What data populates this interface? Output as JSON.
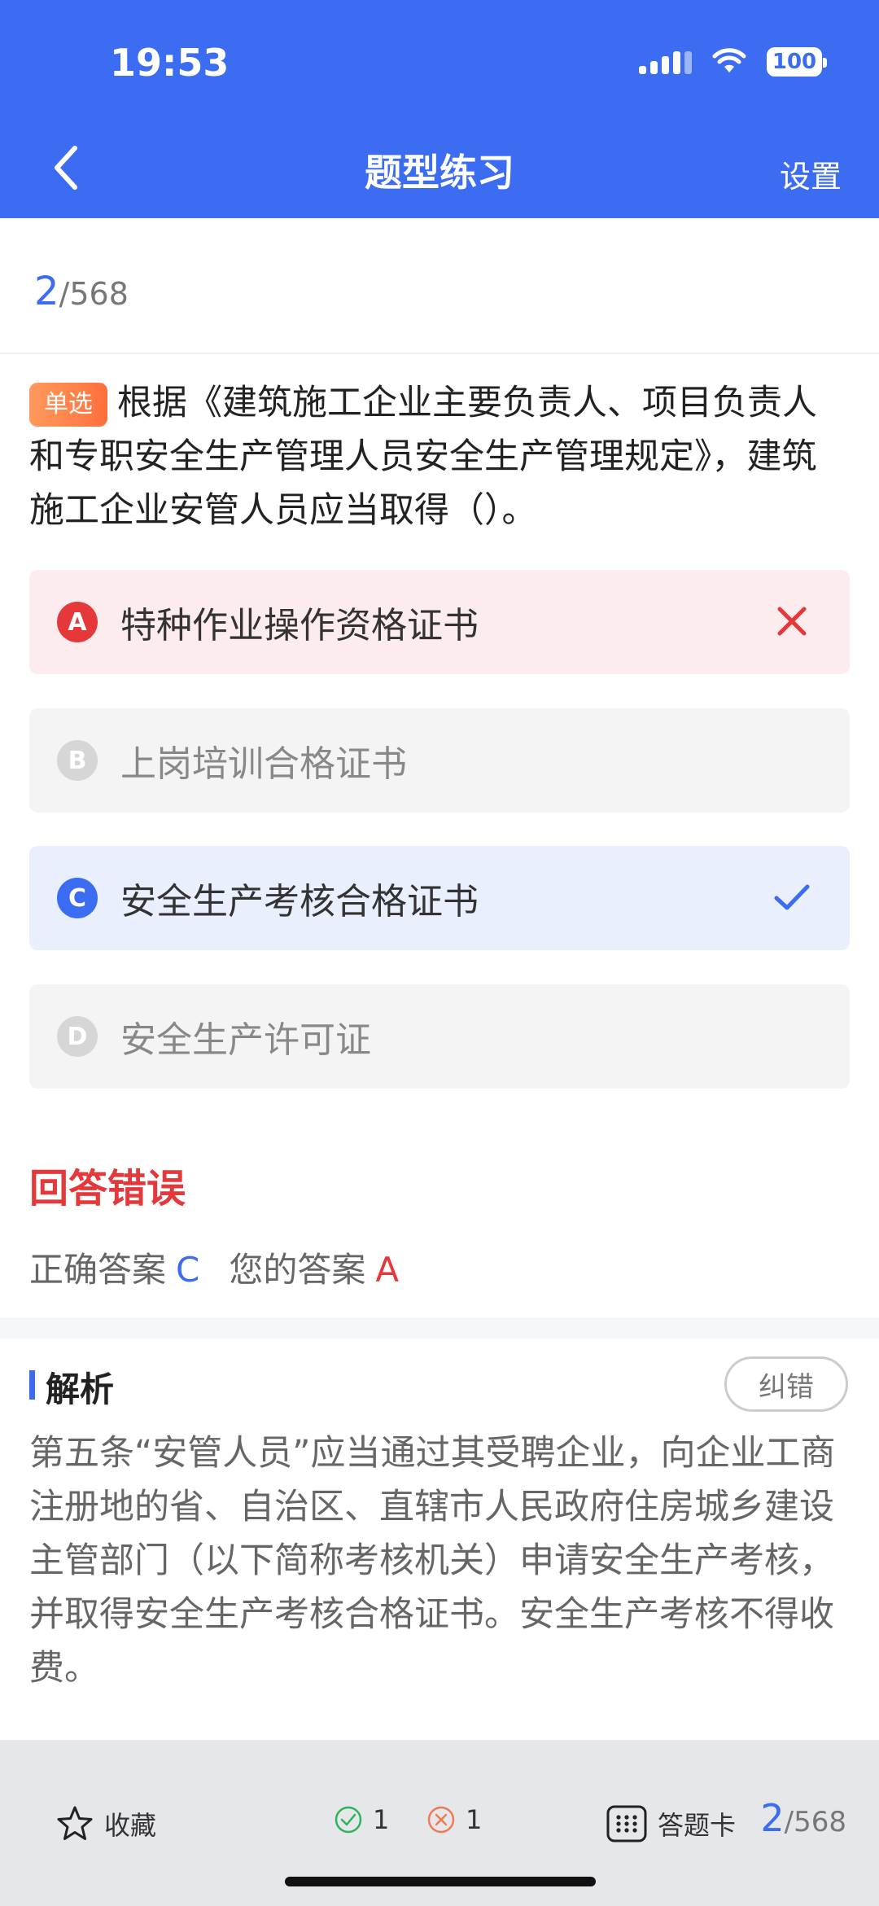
{
  "status_bar": {
    "time": "19:53",
    "battery": "100"
  },
  "nav": {
    "title": "题型练习",
    "settings_label": "设置"
  },
  "progress": {
    "current": "2",
    "total": "/568"
  },
  "question": {
    "type": "单选",
    "text": "根据《建筑施工企业主要负责人、项目负责人和专职安全生产管理人员安全生产管理规定》，建筑施工企业安管人员应当取得（）。"
  },
  "options": [
    {
      "key": "A",
      "text": "特种作业操作资格证书",
      "state": "wrong"
    },
    {
      "key": "B",
      "text": "上岗培训合格证书",
      "state": "normal"
    },
    {
      "key": "C",
      "text": "安全生产考核合格证书",
      "state": "correct"
    },
    {
      "key": "D",
      "text": "安全生产许可证",
      "state": "normal"
    }
  ],
  "result": {
    "title": "回答错误",
    "correct_label": "正确答案",
    "correct_value": "C",
    "yours_label": "您的答案",
    "yours_value": "A"
  },
  "analysis": {
    "title": "解析",
    "report_button": "纠错",
    "text": "第五条“安管人员”应当通过其受聘企业，向企业工商注册地的省、自治区、直辖市人民政府住房城乡建设主管部门（以下简称考核机关）申请安全生产考核，并取得安全生产考核合格证书。安全生产考核不得收费。"
  },
  "footer": {
    "favorite_label": "收藏",
    "correct_count": "1",
    "wrong_count": "1",
    "answer_card_label": "答题卡",
    "progress_current": "2",
    "progress_total": "/568"
  },
  "colors": {
    "primary": "#3b6cf2",
    "error": "#e5383b",
    "success": "#2fb35a"
  }
}
